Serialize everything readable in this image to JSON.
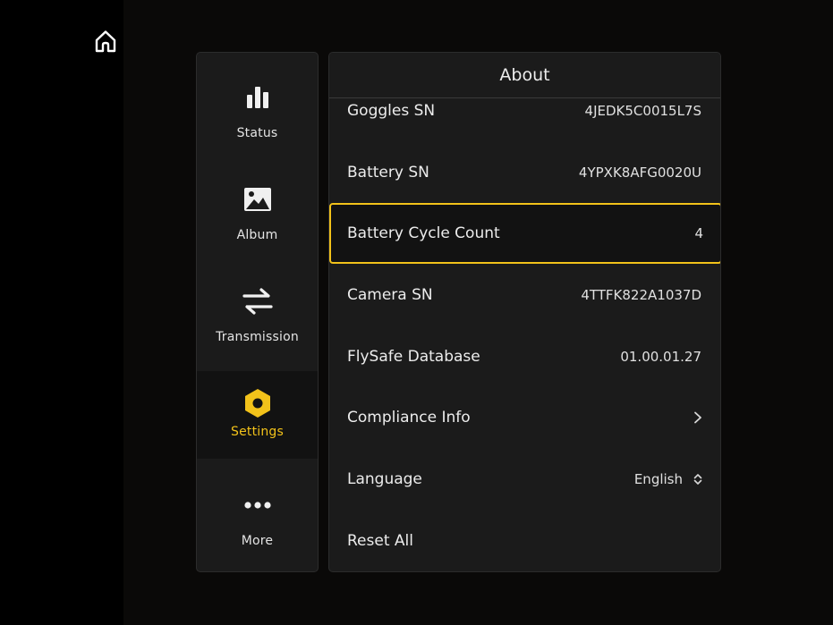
{
  "sidebar": {
    "items": [
      {
        "label": "Status",
        "icon": "bar-chart-icon",
        "active": false
      },
      {
        "label": "Album",
        "icon": "image-icon",
        "active": false
      },
      {
        "label": "Transmission",
        "icon": "transmission-arrows-icon",
        "active": false
      },
      {
        "label": "Settings",
        "icon": "hex-nut-settings-icon",
        "active": true
      },
      {
        "label": "More",
        "icon": "more-dots-icon",
        "active": false
      }
    ]
  },
  "panel": {
    "title": "About",
    "rows": [
      {
        "label": "Goggles SN",
        "value": "4JEDK5C0015L7S"
      },
      {
        "label": "Battery SN",
        "value": "4YPXK8AFG0020U"
      },
      {
        "label": "Battery Cycle Count",
        "value": "4",
        "selected": true
      },
      {
        "label": "Camera SN",
        "value": "4TTFK822A1037D"
      },
      {
        "label": "FlySafe Database",
        "value": "01.00.01.27"
      },
      {
        "label": "Compliance Info",
        "value": "",
        "icon": "chevron-right-icon"
      },
      {
        "label": "Language",
        "value": "English",
        "icon": "up-down-chevron-icon"
      },
      {
        "label": "Reset All",
        "value": ""
      }
    ]
  },
  "colors": {
    "accent": "#f2c21a",
    "panel_bg": "#1b1b1b",
    "page_bg": "#030303",
    "text": "#ececec"
  }
}
